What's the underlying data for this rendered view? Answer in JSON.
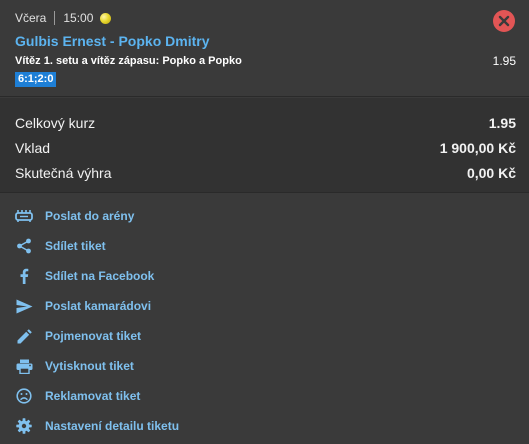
{
  "bet": {
    "day": "Včera",
    "time": "15:00",
    "match": "Gulbis Ernest - Popko Dmitry",
    "market": "Vítěz 1. setu a vítěz zápasu: Popko a Popko",
    "odd": "1.95",
    "score": "6:1;2:0"
  },
  "summary": {
    "rows": [
      {
        "label": "Celkový kurz",
        "value": "1.95"
      },
      {
        "label": "Vklad",
        "value": "1 900,00 Kč"
      },
      {
        "label": "Skutečná výhra",
        "value": "0,00 Kč"
      }
    ]
  },
  "actions": [
    {
      "label": "Poslat do arény",
      "icon": "arena-icon"
    },
    {
      "label": "Sdílet tiket",
      "icon": "share-icon"
    },
    {
      "label": "Sdílet na Facebook",
      "icon": "facebook-icon"
    },
    {
      "label": "Poslat kamarádovi",
      "icon": "send-icon"
    },
    {
      "label": "Pojmenovat tiket",
      "icon": "pencil-icon"
    },
    {
      "label": "Vytisknout tiket",
      "icon": "printer-icon"
    },
    {
      "label": "Reklamovat tiket",
      "icon": "sad-face-icon"
    },
    {
      "label": "Nastavení detailu tiketu",
      "icon": "gear-icon"
    }
  ],
  "colors": {
    "accent": "#5cb4f0",
    "link": "#7fc0ee",
    "close": "#e25555",
    "badge": "#1e7fd6",
    "background": "#3a3a3a"
  }
}
